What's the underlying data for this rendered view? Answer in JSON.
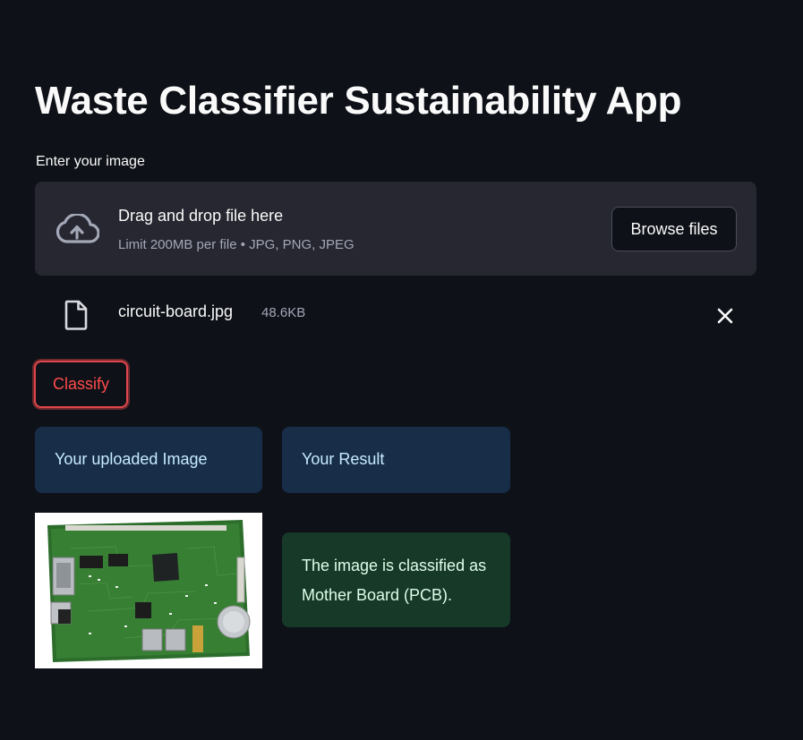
{
  "app": {
    "title": "Waste Classifier Sustainability App"
  },
  "uploader": {
    "label": "Enter your image",
    "drop_title": "Drag and drop file here",
    "drop_subtitle": "Limit 200MB per file • JPG, PNG, JPEG",
    "browse_label": "Browse files",
    "icon": "cloud-upload-icon"
  },
  "uploaded_file": {
    "name": "circuit-board.jpg",
    "size": "48.6KB",
    "icon": "file-icon",
    "remove_icon": "close-icon"
  },
  "actions": {
    "classify_label": "Classify"
  },
  "columns": {
    "left_header": "Your uploaded Image",
    "right_header": "Your Result"
  },
  "result": {
    "message": "The image is classified as Mother Board (PCB)."
  },
  "colors": {
    "background": "#0e1117",
    "surface": "#262730",
    "accent": "#ff4b4b",
    "info_bg": "#172d48",
    "info_text": "#c7ebff",
    "success_bg": "#173928",
    "success_text": "#dffde9"
  }
}
